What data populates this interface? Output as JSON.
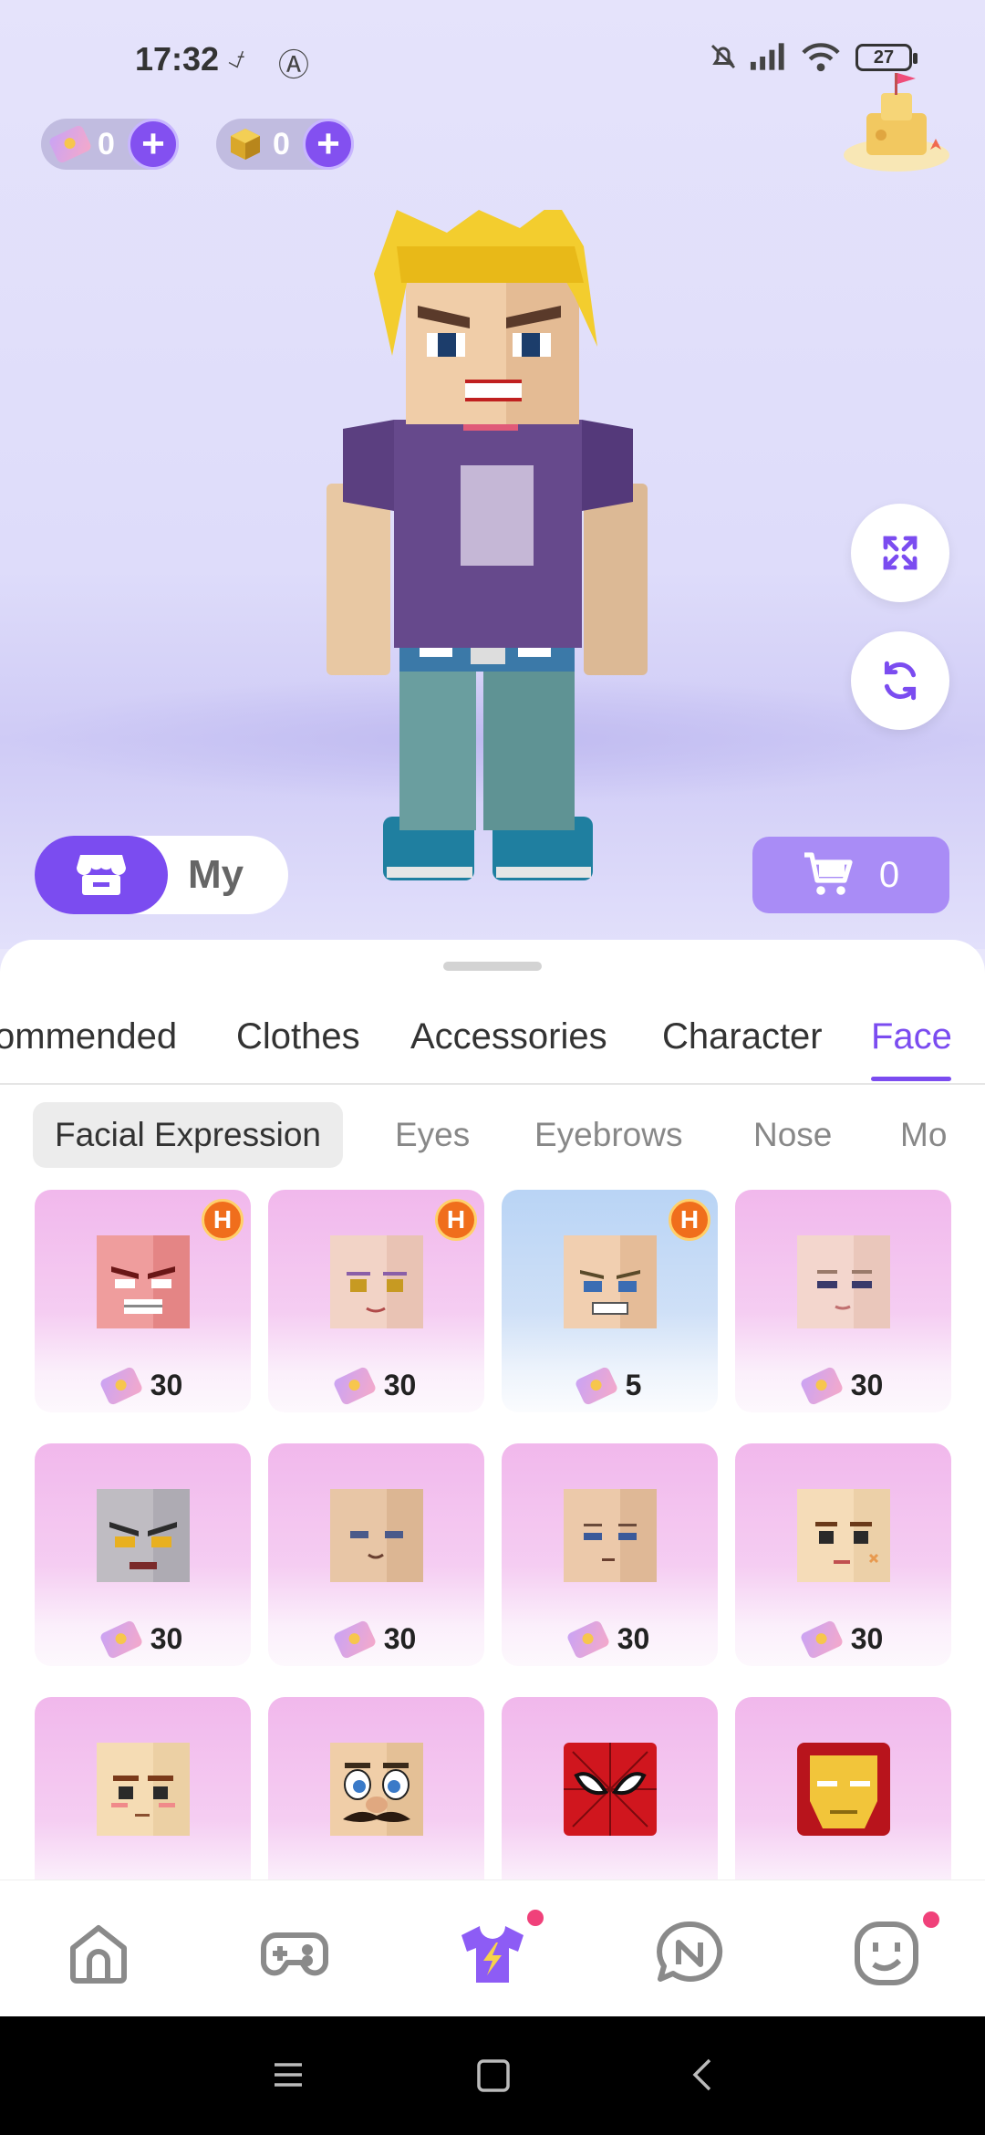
{
  "status_bar": {
    "time": "17:32",
    "battery": "27"
  },
  "currencies": [
    {
      "name": "ticket",
      "value": "0"
    },
    {
      "name": "cube",
      "value": "0"
    }
  ],
  "toggle": {
    "my_label": "My"
  },
  "cart": {
    "count": "0"
  },
  "category_tabs": [
    {
      "label": "ommended",
      "active": false
    },
    {
      "label": "Clothes",
      "active": false
    },
    {
      "label": "Accessories",
      "active": false
    },
    {
      "label": "Character",
      "active": false
    },
    {
      "label": "Face",
      "active": true
    }
  ],
  "sub_tabs": [
    {
      "label": "Facial Expression",
      "active": true
    },
    {
      "label": "Eyes",
      "active": false
    },
    {
      "label": "Eyebrows",
      "active": false
    },
    {
      "label": "Nose",
      "active": false
    },
    {
      "label": "Mo",
      "active": false
    }
  ],
  "items": [
    {
      "price": "30",
      "hot": true,
      "style": "pink",
      "face": "angry-red"
    },
    {
      "price": "30",
      "hot": true,
      "style": "pink",
      "face": "pale-gold-eyes"
    },
    {
      "price": "5",
      "hot": true,
      "style": "blue",
      "face": "grin"
    },
    {
      "price": "30",
      "hot": false,
      "style": "pink",
      "face": "pale-blush"
    },
    {
      "price": "30",
      "hot": false,
      "style": "pink",
      "face": "grey-monster"
    },
    {
      "price": "30",
      "hot": false,
      "style": "pink",
      "face": "tan-smile"
    },
    {
      "price": "30",
      "hot": false,
      "style": "pink",
      "face": "tan-neutral"
    },
    {
      "price": "30",
      "hot": false,
      "style": "pink",
      "face": "tan-bandage"
    },
    {
      "price": "",
      "hot": false,
      "style": "pink",
      "face": "stern-blush"
    },
    {
      "price": "",
      "hot": false,
      "style": "pink",
      "face": "mustache"
    },
    {
      "price": "",
      "hot": false,
      "style": "pink",
      "face": "spider-mask"
    },
    {
      "price": "",
      "hot": false,
      "style": "pink",
      "face": "iron-mask"
    }
  ],
  "bottom_nav": [
    {
      "icon": "home-icon",
      "active": false,
      "dot": false
    },
    {
      "icon": "gamepad-icon",
      "active": false,
      "dot": false
    },
    {
      "icon": "shirt-icon",
      "active": true,
      "dot": true
    },
    {
      "icon": "chat-icon",
      "active": false,
      "dot": false
    },
    {
      "icon": "smiley-icon",
      "active": false,
      "dot": true
    }
  ],
  "colors": {
    "accent": "#7b4cf0",
    "accent_light": "#a98cf6",
    "badge": "#f0417a"
  }
}
